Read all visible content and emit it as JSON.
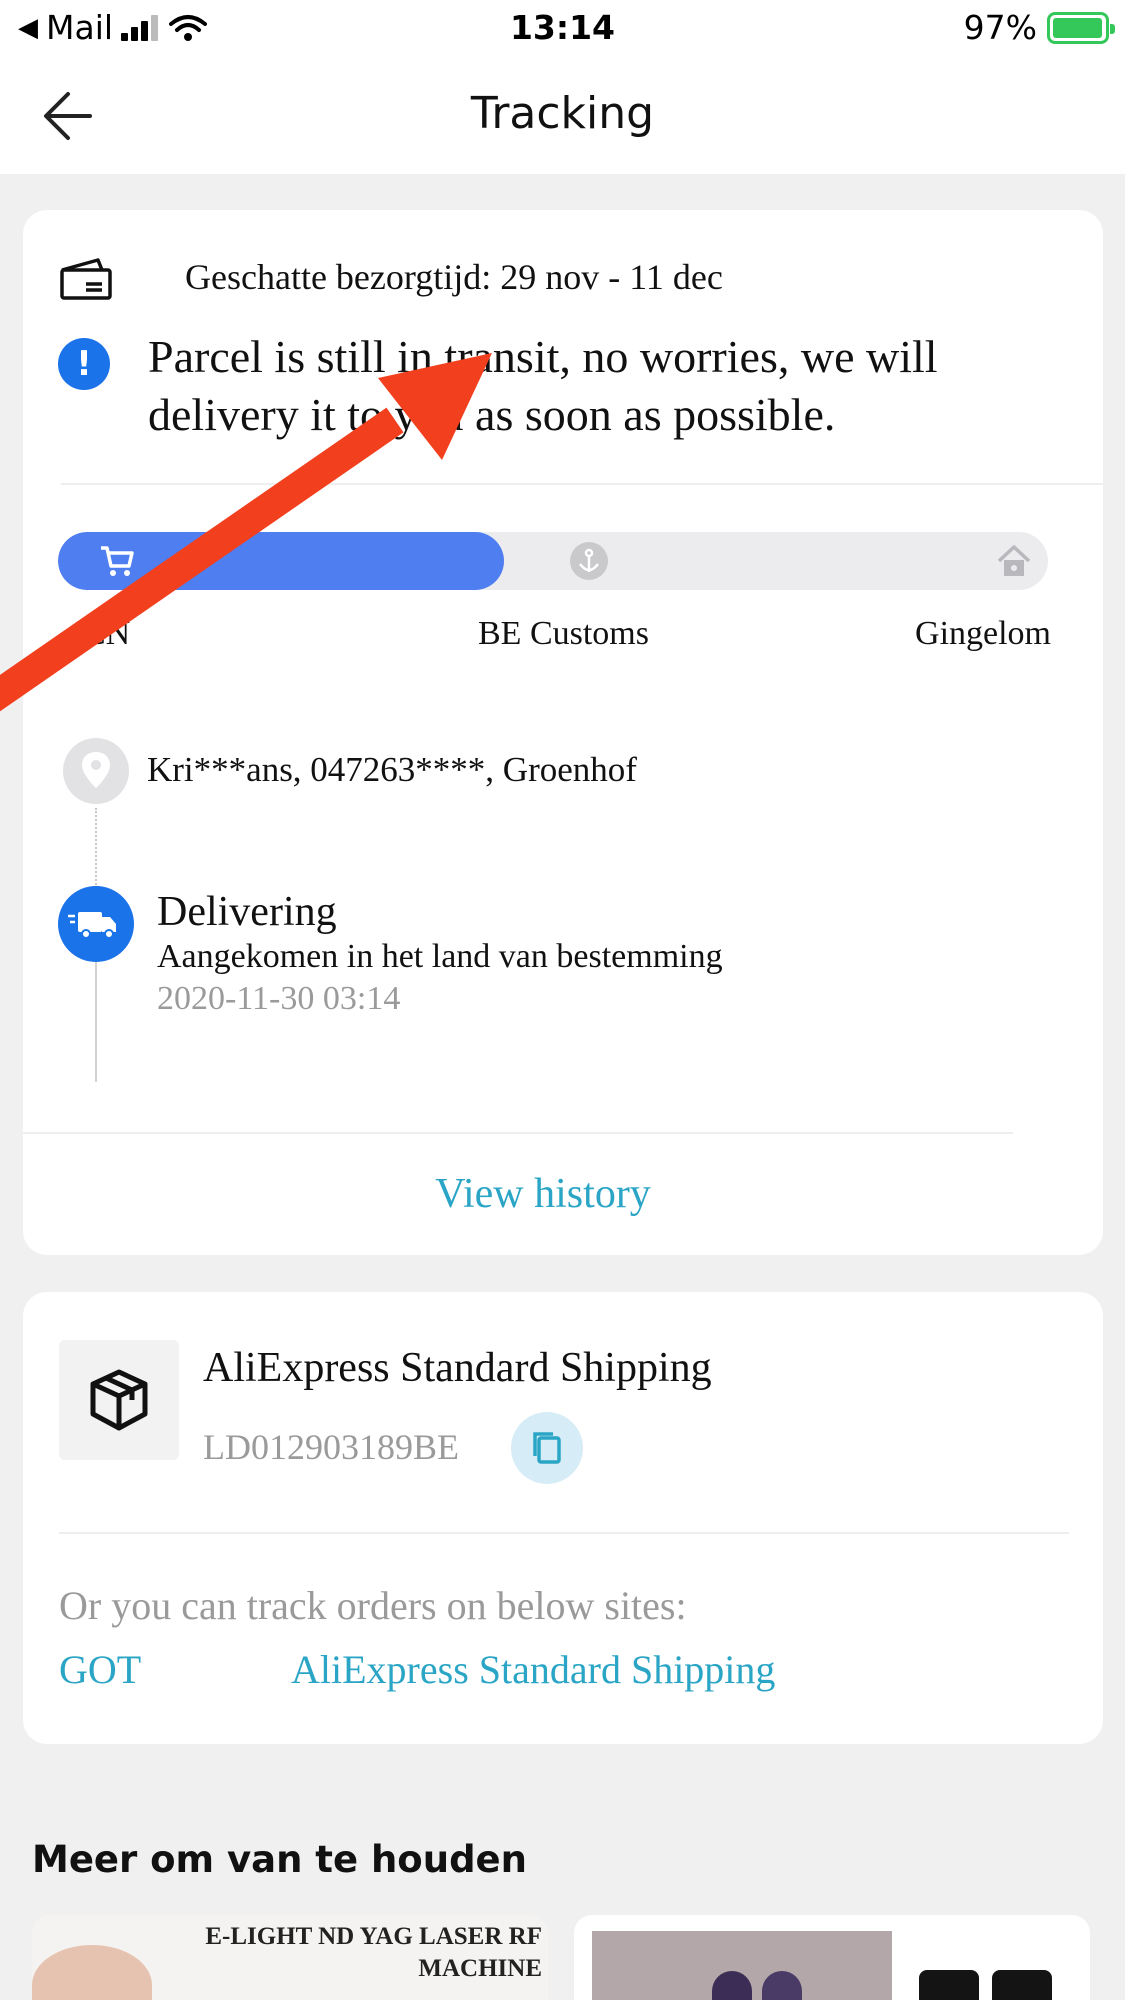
{
  "status_bar": {
    "back_app": "Mail",
    "time": "13:14",
    "battery": "97%",
    "battery_level": 0.97
  },
  "header": {
    "title": "Tracking"
  },
  "tracking": {
    "eta": "Geschatte bezorgtijd: 29 nov - 11 dec",
    "notice": "Parcel is still in transit, no worries, we will delivery it to you as soon as possible.",
    "progress": {
      "level": 0.45,
      "stages": [
        "CN",
        "BE Customs",
        "Gingelom"
      ]
    },
    "address": "Kri***ans,  047263****,  Groenhof",
    "latest_event": {
      "title": "Delivering",
      "description": "Aangekomen in het land van bestemming",
      "time": "2020-11-30 03:14"
    },
    "view_history": "View history",
    "accent": "#4f7ef0",
    "link_color": "#2aa5c5"
  },
  "shipping": {
    "name": "AliExpress Standard Shipping",
    "code": "LD012903189BE",
    "alt_text": "Or you can track orders on below sites:",
    "alt_links": [
      "GOT",
      "AliExpress Standard Shipping"
    ]
  },
  "recommendations": {
    "title": "Meer om van te houden",
    "items": [
      {
        "image_text": "E-LIGHT ND YAG LASER RF MACHINE"
      }
    ]
  },
  "annotation": {
    "color": "#f2401f"
  }
}
